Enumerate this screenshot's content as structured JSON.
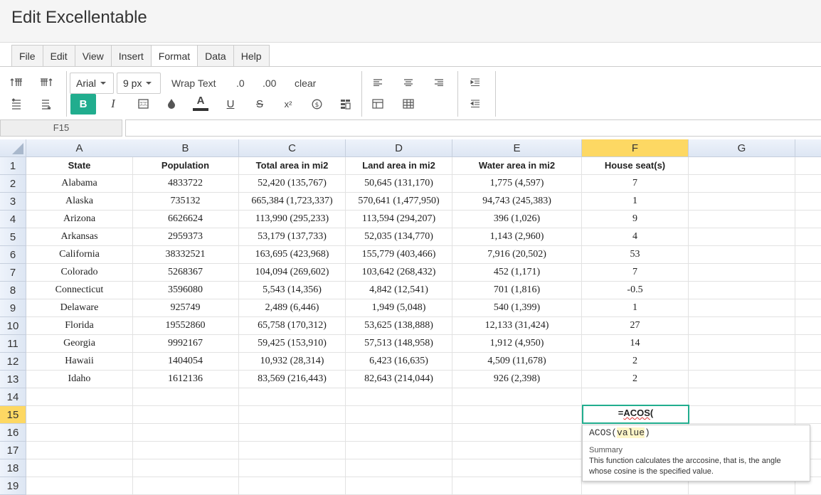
{
  "page_title": "Edit Excellentable",
  "menu": [
    "File",
    "Edit",
    "View",
    "Insert",
    "Format",
    "Data",
    "Help"
  ],
  "active_menu": "Format",
  "toolbar": {
    "font_family": "Arial",
    "font_size": "9 px",
    "wrap_text": "Wrap Text",
    "decrease_decimal": ".0",
    "increase_decimal": ".00",
    "clear": "clear",
    "bold": "B",
    "italic": "I",
    "underline": "U",
    "strike": "S",
    "superscript": "x²",
    "font_color": "#333333",
    "accent": "#21ad8e"
  },
  "name_box": "F15",
  "formula_value": "",
  "columns": [
    "A",
    "B",
    "C",
    "D",
    "E",
    "F",
    "G"
  ],
  "selected_column": "F",
  "rows": [
    "1",
    "2",
    "3",
    "4",
    "5",
    "6",
    "7",
    "8",
    "9",
    "10",
    "11",
    "12",
    "13",
    "14",
    "15",
    "16",
    "17",
    "18",
    "19"
  ],
  "selected_row": "15",
  "header_row": [
    "State",
    "Population",
    "Total area in mi2",
    "Land area in mi2",
    "Water area in mi2",
    "House seat(s)",
    ""
  ],
  "data_rows": [
    [
      "Alabama",
      "4833722",
      "52,420 (135,767)",
      "50,645 (131,170)",
      "1,775 (4,597)",
      "7",
      ""
    ],
    [
      "Alaska",
      "735132",
      "665,384 (1,723,337)",
      "570,641 (1,477,950)",
      "94,743 (245,383)",
      "1",
      ""
    ],
    [
      "Arizona",
      "6626624",
      "113,990 (295,233)",
      "113,594 (294,207)",
      "396 (1,026)",
      "9",
      ""
    ],
    [
      "Arkansas",
      "2959373",
      "53,179 (137,733)",
      "52,035 (134,770)",
      "1,143 (2,960)",
      "4",
      ""
    ],
    [
      "California",
      "38332521",
      "163,695 (423,968)",
      "155,779 (403,466)",
      "7,916 (20,502)",
      "53",
      ""
    ],
    [
      "Colorado",
      "5268367",
      "104,094 (269,602)",
      "103,642 (268,432)",
      "452 (1,171)",
      "7",
      ""
    ],
    [
      "Connecticut",
      "3596080",
      "5,543 (14,356)",
      "4,842 (12,541)",
      "701 (1,816)",
      "-0.5",
      ""
    ],
    [
      "Delaware",
      "925749",
      "2,489 (6,446)",
      "1,949 (5,048)",
      "540 (1,399)",
      "1",
      ""
    ],
    [
      "Florida",
      "19552860",
      "65,758 (170,312)",
      "53,625 (138,888)",
      "12,133 (31,424)",
      "27",
      ""
    ],
    [
      "Georgia",
      "9992167",
      "59,425 (153,910)",
      "57,513 (148,958)",
      "1,912 (4,950)",
      "14",
      ""
    ],
    [
      "Hawaii",
      "1404054",
      "10,932 (28,314)",
      "6,423 (16,635)",
      "4,509 (11,678)",
      "2",
      ""
    ],
    [
      "Idaho",
      "1612136",
      "83,569 (216,443)",
      "82,643 (214,044)",
      "926 (2,398)",
      "2",
      ""
    ]
  ],
  "active_cell": {
    "prefix": "=",
    "fn": "ACOS",
    "suffix": "("
  },
  "tooltip": {
    "fn_name": "ACOS",
    "open_paren": "(",
    "param": "value",
    "close_paren": ")",
    "summary_label": "Summary",
    "summary_text": "This function calculates the arccosine, that is, the angle whose cosine is the specified value."
  }
}
